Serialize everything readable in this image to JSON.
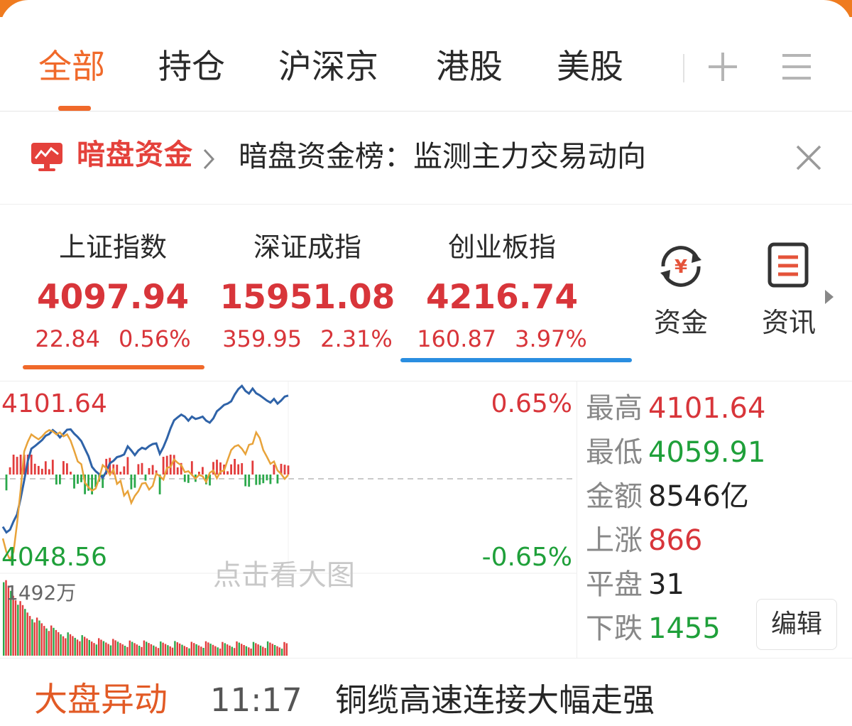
{
  "tabs": [
    {
      "label": "全部",
      "active": true
    },
    {
      "label": "持仓",
      "active": false
    },
    {
      "label": "沪深京",
      "active": false
    },
    {
      "label": "港股",
      "active": false
    },
    {
      "label": "美股",
      "active": false
    }
  ],
  "tab_icons": [
    "plus-icon",
    "menu-icon"
  ],
  "banner": {
    "brand": "暗盘资金",
    "text": "暗盘资金榜：监测主力交易动向",
    "icons": [
      "dark-pool-monitor-icon",
      "chevron-right-icon",
      "close-icon"
    ]
  },
  "indices": [
    {
      "name": "上证指数",
      "value": "4097.94",
      "change": "22.84",
      "pct": "0.56%"
    },
    {
      "name": "深证成指",
      "value": "15951.08",
      "change": "359.95",
      "pct": "2.31%"
    },
    {
      "name": "创业板指",
      "value": "4216.74",
      "change": "160.87",
      "pct": "3.97%"
    }
  ],
  "quick_links": [
    {
      "label": "资金",
      "icon": "yuan-exchange-icon"
    },
    {
      "label": "资讯",
      "icon": "news-icon"
    }
  ],
  "chart": {
    "high_label": "4101.64",
    "low_label": "4048.56",
    "up_pct": "0.65%",
    "down_pct": "-0.65%",
    "volume_label": "1492万",
    "watermark": "点击看大图"
  },
  "chart_data": {
    "type": "line",
    "ylim": [
      4048.56,
      4101.64
    ],
    "reference": 4075.1,
    "series": [
      {
        "values": [
          4059.5,
          4057.8,
          4058.6,
          4061.1,
          4063.2,
          4068.0,
          4073.4,
          4079.2,
          4082.8,
          4083.6,
          4084.5,
          4085.4,
          4086.7,
          4087.2,
          4088.4,
          4087.5,
          4086.2,
          4087.3,
          4088.5,
          4088.6,
          4087.3,
          4086.3,
          4085.1,
          4082.8,
          4080.6,
          4077.4,
          4076.1,
          4075.2,
          4074.1,
          4076.0,
          4078.5,
          4079.2,
          4080.3,
          4080.6,
          4081.1,
          4083.5,
          4082.3,
          4080.9,
          4082.3,
          4083.1,
          4082.7,
          4083.6,
          4084.2,
          4084.4,
          4081.3,
          4083.3,
          4085.9,
          4088.9,
          4091.3,
          4092.2,
          4093.0,
          4092.4,
          4091.2,
          4092.4,
          4091.7,
          4092.0,
          4092.4,
          4091.2,
          4090.6,
          4091.9,
          4094.0,
          4094.9,
          4095.9,
          4096.3,
          4097.0,
          4099.0,
          4100.6,
          4101.6,
          4100.1,
          4099.3,
          4100.8,
          4099.4,
          4098.8,
          4098.0,
          4097.2,
          4096.6,
          4097.7,
          4096.3,
          4097.2,
          4098.4,
          4098.7
        ]
      },
      {
        "values": [
          4056.0,
          4052.0,
          4049.6,
          4052.0,
          4060.6,
          4070.6,
          4082.0,
          4084.9,
          4087.1,
          4086.3,
          4085.6,
          4086.5,
          4087.7,
          4088.4,
          4088.0,
          4087.1,
          4087.7,
          4086.5,
          4087.1,
          4085.2,
          4082.2,
          4079.0,
          4078.2,
          4072.7,
          4071.3,
          4070.3,
          4070.9,
          4074.0,
          4077.9,
          4077.0,
          4075.0,
          4076.6,
          4072.3,
          4073.2,
          4068.8,
          4070.1,
          4066.6,
          4068.7,
          4070.1,
          4072.4,
          4072.6,
          4070.6,
          4071.7,
          4075.4,
          4074.6,
          4073.6,
          4077.1,
          4077.4,
          4079.6,
          4078.6,
          4077.9,
          4075.8,
          4076.1,
          4075.0,
          4073.9,
          4075.0,
          4074.6,
          4072.9,
          4075.6,
          4076.3,
          4074.0,
          4076.0,
          4076.3,
          4079.4,
          4082.4,
          4083.5,
          4083.9,
          4082.8,
          4081.2,
          4084.0,
          4084.3,
          4087.7,
          4086.0,
          4082.4,
          4080.4,
          4078.3,
          4079.0,
          4076.3,
          4075.3,
          4073.8,
          4075.0
        ]
      }
    ],
    "volume_max": 1492
  },
  "stats": [
    {
      "label": "最高",
      "value": "4101.64",
      "color": "#d8353a"
    },
    {
      "label": "最低",
      "value": "4059.91",
      "color": "#1fa03a"
    },
    {
      "label": "金额",
      "value": "8546亿",
      "color": "#222222"
    },
    {
      "label": "上涨",
      "value": "866",
      "color": "#d8353a"
    },
    {
      "label": "平盘",
      "value": "31",
      "color": "#222222"
    },
    {
      "label": "下跌",
      "value": "1455",
      "color": "#1fa03a"
    }
  ],
  "edit_label": "编辑",
  "ticker": {
    "label": "大盘异动",
    "time": "11:17",
    "text": "铜缆高速连接大幅走强"
  },
  "colors": {
    "accent": "#f0692a",
    "up": "#d8353a",
    "down": "#1fa03a",
    "selected_underline": "#2a8ee0"
  }
}
